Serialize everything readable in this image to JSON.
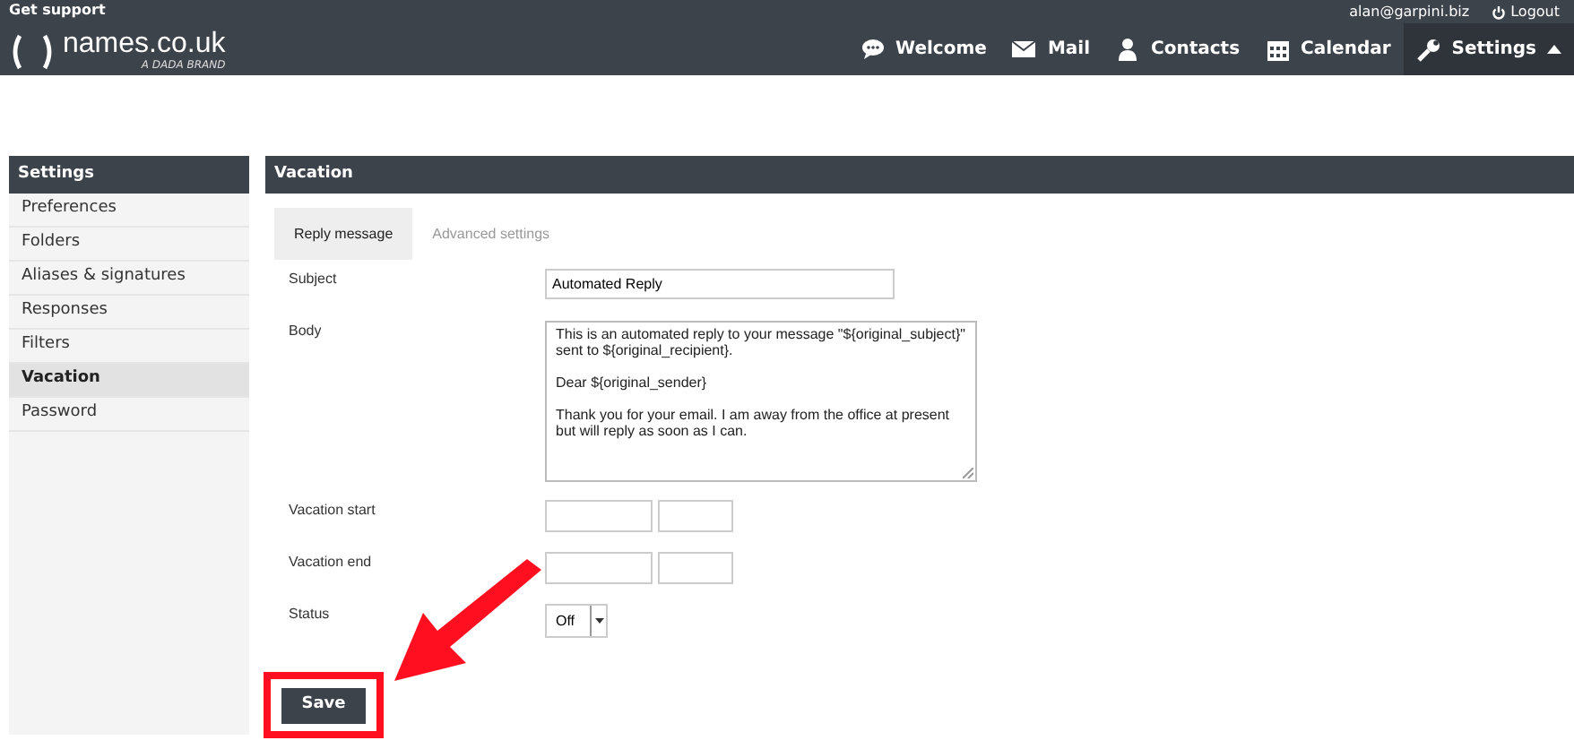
{
  "top_bar": {
    "support_link": "Get support",
    "user": "alan@garpini.biz",
    "logout": "Logout"
  },
  "logo": {
    "name": "names.co.uk",
    "tagline": "A DADA BRAND"
  },
  "nav": [
    {
      "label": "Welcome",
      "kind": "chat",
      "selected": false
    },
    {
      "label": "Mail",
      "kind": "mail",
      "selected": false
    },
    {
      "label": "Contacts",
      "kind": "person",
      "selected": false
    },
    {
      "label": "Calendar",
      "kind": "calendar",
      "selected": false
    },
    {
      "label": "Settings",
      "kind": "wrench",
      "selected": true
    }
  ],
  "sidebar": {
    "title": "Settings",
    "items": [
      {
        "label": "Preferences",
        "selected": false
      },
      {
        "label": "Folders",
        "selected": false
      },
      {
        "label": "Aliases & signatures",
        "selected": false
      },
      {
        "label": "Responses",
        "selected": false
      },
      {
        "label": "Filters",
        "selected": false
      },
      {
        "label": "Vacation",
        "selected": true
      },
      {
        "label": "Password",
        "selected": false
      }
    ]
  },
  "panel": {
    "title": "Vacation",
    "tabs": [
      {
        "label": "Reply message",
        "selected": true
      },
      {
        "label": "Advanced settings",
        "selected": false
      }
    ],
    "fields": [
      {
        "kind": "text",
        "label": "Subject",
        "value": "Automated Reply"
      },
      {
        "kind": "textarea",
        "label": "Body",
        "paragraphs": [
          "This is an automated reply to your message \"${original_subject}\" sent to ${original_recipient}.",
          "Dear ${original_sender}",
          "Thank you for your email. I am away from the office at present but will reply as soon as I can."
        ]
      },
      {
        "kind": "datetime",
        "label": "Vacation start"
      },
      {
        "kind": "datetime",
        "label": "Vacation end"
      },
      {
        "kind": "select",
        "label": "Status",
        "value": "Off"
      }
    ],
    "save_button": "Save"
  }
}
